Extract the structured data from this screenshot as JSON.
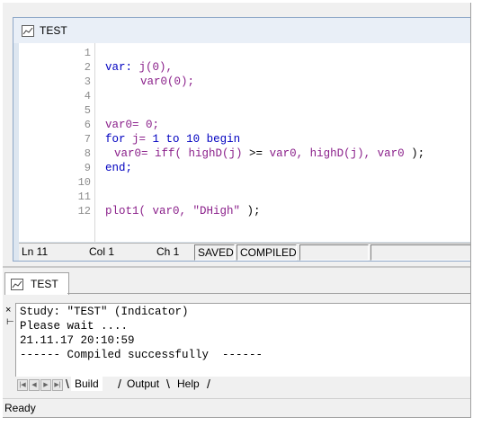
{
  "editor": {
    "title": "TEST",
    "line_numbers": [
      "1",
      "2",
      "3",
      "4",
      "5",
      "6",
      "7",
      "8",
      "9",
      "10",
      "11",
      "12"
    ],
    "code": {
      "l2a": "var:",
      "l2b": " j(0),",
      "l3": "var0(0);",
      "l6": "var0= 0;",
      "l7a": "for",
      "l7b": " j=",
      "l7c": " 1",
      "l7d": " to",
      "l7e": " 10",
      "l7f": " begin",
      "l8a": "var0=",
      "l8b": " iff(",
      "l8c": " highD(j)",
      "l8d": " >=",
      "l8e": " var0,",
      "l8f": " highD(j),",
      "l8g": " var0",
      "l8h": " );",
      "l9": "end;",
      "l12a": "plot1(",
      "l12b": " var0,",
      "l12c": " \"DHigh\"",
      "l12d": " );"
    },
    "status": {
      "ln": "Ln 11",
      "col": "Col 1",
      "ch": "Ch 1",
      "saved": "SAVED",
      "compiled": "COMPILED"
    }
  },
  "output": {
    "tab_title": "TEST",
    "close_glyph": "×",
    "pin_glyph": "⊢",
    "messages": [
      "Study: \"TEST\" (Indicator)",
      "Please wait ....",
      "21.11.17 20:10:59",
      "------ Compiled successfully  ------"
    ],
    "tabs": [
      "Build",
      "Output",
      "Help"
    ]
  },
  "status_bar": {
    "text": "Ready"
  },
  "colors": {
    "keyword": "#0000c0",
    "function": "#8a1f8a"
  }
}
